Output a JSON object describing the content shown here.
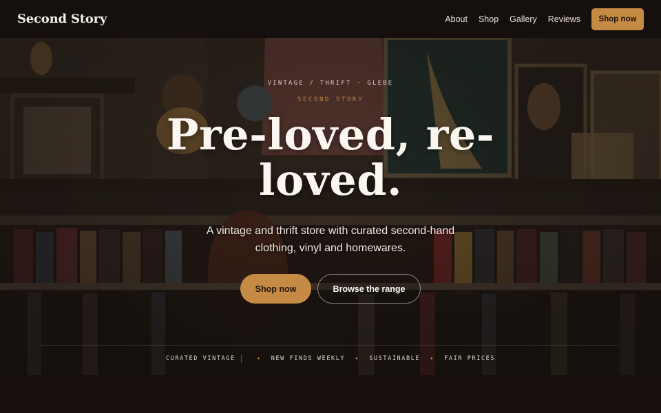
{
  "nav": {
    "brand": "Second Story",
    "links": [
      "About",
      "Shop",
      "Gallery",
      "Reviews"
    ],
    "cta": "Shop now"
  },
  "hero": {
    "eyebrow": "VINTAGE / THRIFT · GLEBE",
    "subeyebrow": "SECOND STORY",
    "headline": "Pre-loved, re-loved.",
    "lead": "A vintage and thrift store with curated second-hand clothing, vinyl and homewares.",
    "primary_button": "Shop now",
    "secondary_button": "Browse the range",
    "features": [
      "CURATED VINTAGE",
      "NEW FINDS WEEKLY",
      "SUSTAINABLE",
      "FAIR PRICES"
    ],
    "background_description_icon": "thrift-store-photo"
  },
  "colors": {
    "accent": "#c58a44",
    "nav_bg": "#15100d",
    "page_bg": "#140f0c",
    "text": "#f3ede4"
  }
}
